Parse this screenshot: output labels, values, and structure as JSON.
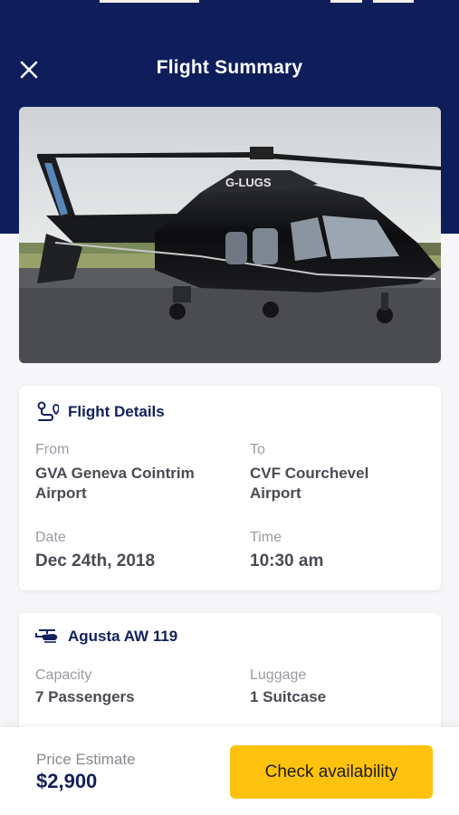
{
  "header": {
    "title": "Flight Summary"
  },
  "flight_details": {
    "title": "Flight Details",
    "from_label": "From",
    "from_value_line1": "GVA Geneva Cointrim",
    "from_value_line2": "Airport",
    "to_label": "To",
    "to_value_line1": "CVF Courchevel",
    "to_value_line2": "Airport",
    "date_label": "Date",
    "date_value": "Dec 24th, 2018",
    "time_label": "Time",
    "time_value": "10:30 am"
  },
  "aircraft": {
    "title": "Agusta AW 119",
    "capacity_label": "Capacity",
    "capacity_value": "7 Passengers",
    "luggage_label": "Luggage",
    "luggage_value": "1 Suitcase"
  },
  "footer": {
    "price_label": "Price Estimate",
    "price_value": "$2,900",
    "cta_label": "Check availability"
  },
  "photo": {
    "registration": "G-LUGS"
  },
  "colors": {
    "navy": "#0f1e5a",
    "accent": "#ffc20e",
    "card": "#ffffff",
    "background": "#f6f6f8"
  },
  "icons": {
    "close": "close-icon",
    "route": "route-icon",
    "helicopter": "helicopter-icon"
  }
}
